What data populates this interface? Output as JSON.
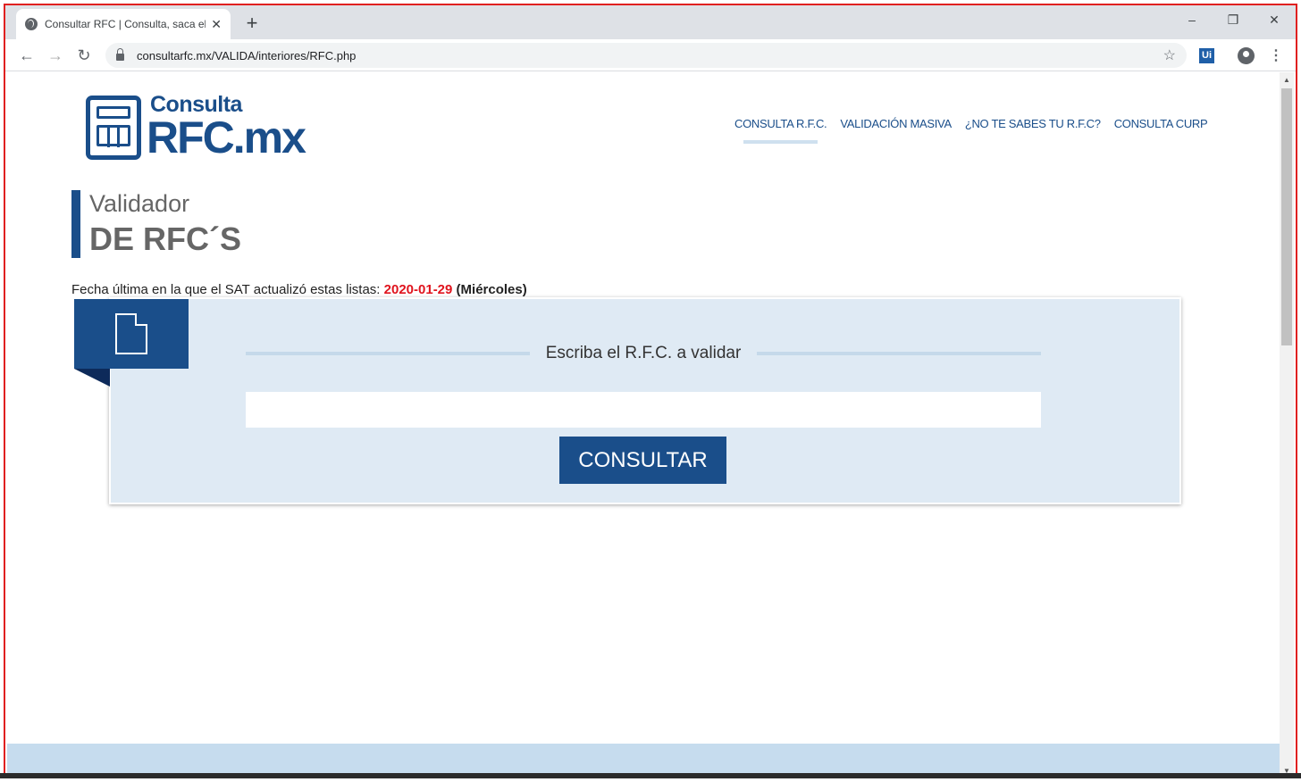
{
  "browser": {
    "tab_title": "Consultar RFC | Consulta, saca el RFC",
    "new_tab": "+",
    "url": "consultarfc.mx/VALIDA/interiores/RFC.php",
    "ext_label": "Ui",
    "controls": {
      "minimize": "–",
      "restore": "❐",
      "close": "✕",
      "tab_close": "✕",
      "back": "←",
      "forward": "→",
      "reload": "↻",
      "star": "☆",
      "menu": "⋮"
    }
  },
  "logo": {
    "top": "Consulta",
    "main": "RFC.mx"
  },
  "nav": [
    {
      "label": "CONSULTA R.F.C.",
      "active": true
    },
    {
      "label": "VALIDACIÓN MASIVA"
    },
    {
      "label": "¿NO TE SABES TU R.F.C?"
    },
    {
      "label": "CONSULTA CURP"
    }
  ],
  "heading": {
    "line1": "Validador",
    "line2": "DE RFC´S"
  },
  "update_info": {
    "prefix": "Fecha última en la que el SAT actualizó estas listas:",
    "date": "2020-01-29",
    "weekday": "(Miércoles)"
  },
  "form": {
    "label": "Escriba el R.F.C. a validar",
    "input_value": "",
    "button": "CONSULTAR"
  },
  "colors": {
    "brand": "#1a4e8a",
    "panel": "#dfeaf4",
    "date": "#e0141e"
  }
}
